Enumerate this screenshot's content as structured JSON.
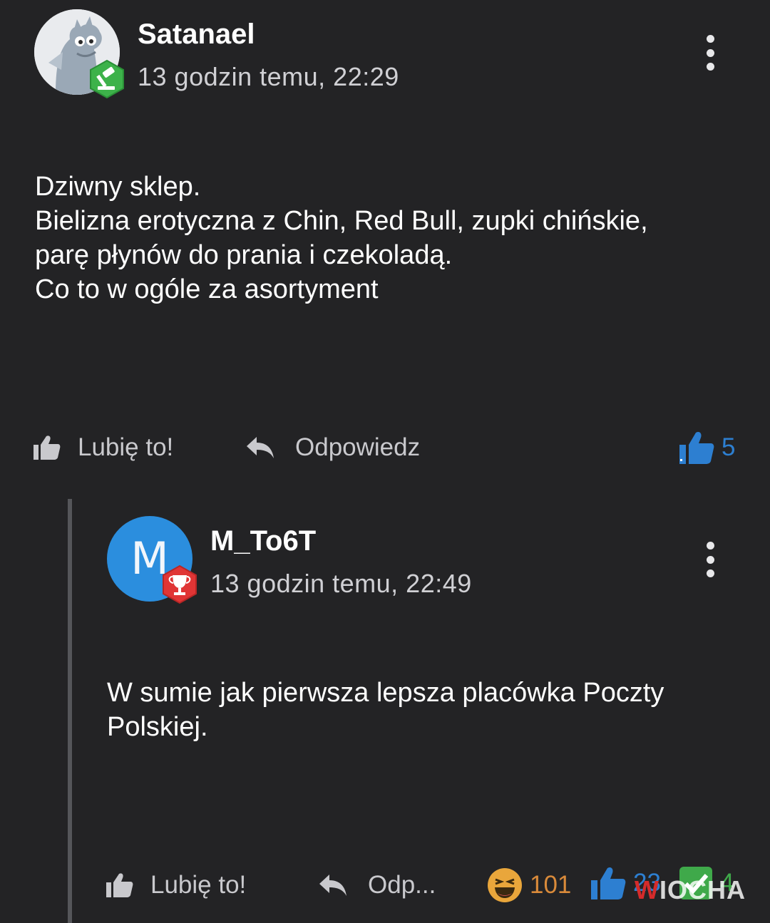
{
  "comments": [
    {
      "username": "Satanael",
      "timestamp": "13 godzin temu, 22:29",
      "body": [
        "Dziwny sklep.",
        "Bielizna erotyczna z Chin, Red Bull, zupki chińskie,",
        "parę płynów do prania i czekoladą.",
        "Co to w ogóle za asortyment"
      ],
      "like_label": "Lubię to!",
      "reply_label": "Odpowiedz",
      "like_count": "5",
      "badge_icon": "gavel-icon"
    },
    {
      "username": "M_To6T",
      "avatar_letter": "M",
      "timestamp": "13 godzin temu, 22:49",
      "body": [
        "W sumie jak pierwsza lepsza placówka Poczty",
        "Polskiej."
      ],
      "like_label": "Lubię to!",
      "reply_label": "Odp...",
      "reactions": {
        "laugh_count": "101",
        "like_count": "23",
        "check_count": "4"
      },
      "badge_icon": "trophy-icon"
    }
  ],
  "watermark": {
    "first": "W",
    "rest": "IOCHA"
  },
  "colors": {
    "background": "#232325",
    "like_blue": "#2d7fd1",
    "laugh_orange": "#d98a3a",
    "check_green": "#3fa94a",
    "avatar_blue": "#2b8ede"
  }
}
